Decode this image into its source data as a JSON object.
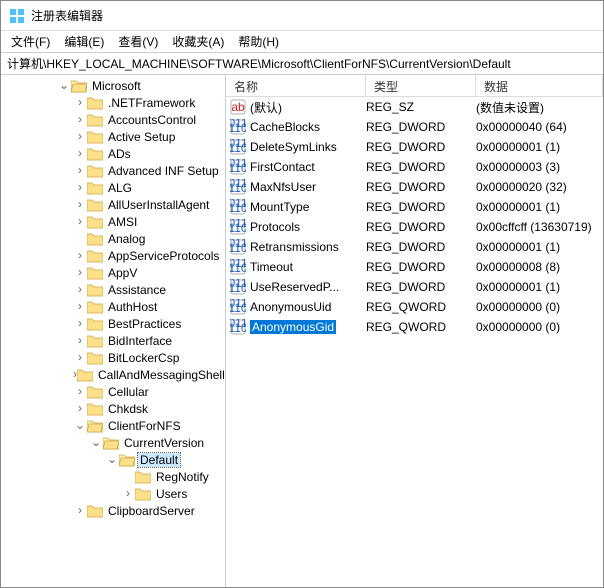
{
  "window": {
    "title": "注册表编辑器"
  },
  "menu": {
    "file": "文件(F)",
    "edit": "编辑(E)",
    "view": "查看(V)",
    "fav": "收藏夹(A)",
    "help": "帮助(H)"
  },
  "address": "计算机\\HKEY_LOCAL_MACHINE\\SOFTWARE\\Microsoft\\ClientForNFS\\CurrentVersion\\Default",
  "columns": {
    "name": "名称",
    "type": "类型",
    "data": "数据"
  },
  "tree": [
    {
      "indent": 3,
      "tw": "open",
      "label": "Microsoft",
      "sel": false
    },
    {
      "indent": 4,
      "tw": "closed",
      "label": ".NETFramework"
    },
    {
      "indent": 4,
      "tw": "closed",
      "label": "AccountsControl"
    },
    {
      "indent": 4,
      "tw": "closed",
      "label": "Active Setup"
    },
    {
      "indent": 4,
      "tw": "closed",
      "label": "ADs"
    },
    {
      "indent": 4,
      "tw": "closed",
      "label": "Advanced INF Setup"
    },
    {
      "indent": 4,
      "tw": "closed",
      "label": "ALG"
    },
    {
      "indent": 4,
      "tw": "closed",
      "label": "AllUserInstallAgent"
    },
    {
      "indent": 4,
      "tw": "closed",
      "label": "AMSI"
    },
    {
      "indent": 4,
      "tw": "none",
      "label": "Analog"
    },
    {
      "indent": 4,
      "tw": "closed",
      "label": "AppServiceProtocols"
    },
    {
      "indent": 4,
      "tw": "closed",
      "label": "AppV"
    },
    {
      "indent": 4,
      "tw": "closed",
      "label": "Assistance"
    },
    {
      "indent": 4,
      "tw": "closed",
      "label": "AuthHost"
    },
    {
      "indent": 4,
      "tw": "closed",
      "label": "BestPractices"
    },
    {
      "indent": 4,
      "tw": "closed",
      "label": "BidInterface"
    },
    {
      "indent": 4,
      "tw": "closed",
      "label": "BitLockerCsp"
    },
    {
      "indent": 4,
      "tw": "closed",
      "label": "CallAndMessagingShell"
    },
    {
      "indent": 4,
      "tw": "closed",
      "label": "Cellular"
    },
    {
      "indent": 4,
      "tw": "closed",
      "label": "Chkdsk"
    },
    {
      "indent": 4,
      "tw": "open",
      "label": "ClientForNFS"
    },
    {
      "indent": 5,
      "tw": "open",
      "label": "CurrentVersion"
    },
    {
      "indent": 6,
      "tw": "open",
      "label": "Default",
      "sel": true
    },
    {
      "indent": 7,
      "tw": "none",
      "label": "RegNotify"
    },
    {
      "indent": 7,
      "tw": "closed",
      "label": "Users"
    },
    {
      "indent": 4,
      "tw": "closed",
      "label": "ClipboardServer"
    }
  ],
  "values": [
    {
      "icon": "str",
      "name": "(默认)",
      "type": "REG_SZ",
      "data": "(数值未设置)",
      "sel": false
    },
    {
      "icon": "bin",
      "name": "CacheBlocks",
      "type": "REG_DWORD",
      "data": "0x00000040 (64)"
    },
    {
      "icon": "bin",
      "name": "DeleteSymLinks",
      "type": "REG_DWORD",
      "data": "0x00000001 (1)"
    },
    {
      "icon": "bin",
      "name": "FirstContact",
      "type": "REG_DWORD",
      "data": "0x00000003 (3)"
    },
    {
      "icon": "bin",
      "name": "MaxNfsUser",
      "type": "REG_DWORD",
      "data": "0x00000020 (32)"
    },
    {
      "icon": "bin",
      "name": "MountType",
      "type": "REG_DWORD",
      "data": "0x00000001 (1)"
    },
    {
      "icon": "bin",
      "name": "Protocols",
      "type": "REG_DWORD",
      "data": "0x00cffcff (13630719)"
    },
    {
      "icon": "bin",
      "name": "Retransmissions",
      "type": "REG_DWORD",
      "data": "0x00000001 (1)"
    },
    {
      "icon": "bin",
      "name": "Timeout",
      "type": "REG_DWORD",
      "data": "0x00000008 (8)"
    },
    {
      "icon": "bin",
      "name": "UseReservedP...",
      "type": "REG_DWORD",
      "data": "0x00000001 (1)"
    },
    {
      "icon": "bin",
      "name": "AnonymousUid",
      "type": "REG_QWORD",
      "data": "0x00000000 (0)"
    },
    {
      "icon": "bin",
      "name": "AnonymousGid",
      "type": "REG_QWORD",
      "data": "0x00000000 (0)",
      "sel": true
    }
  ],
  "indent_unit": 16,
  "base_indent": 8
}
